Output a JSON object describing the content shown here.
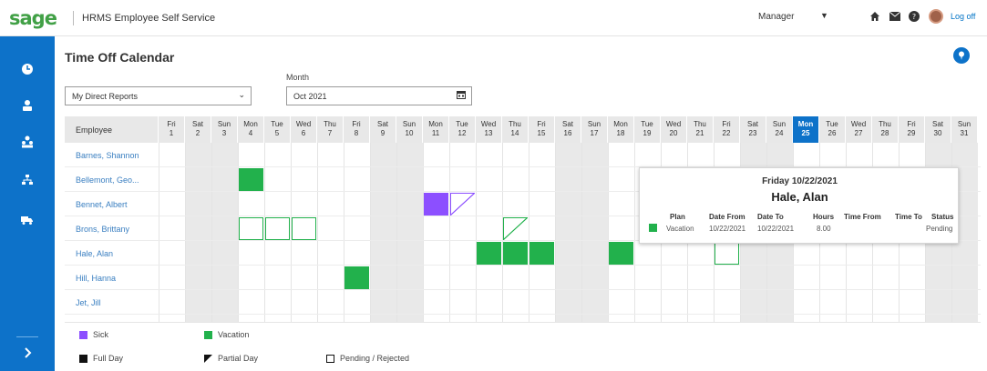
{
  "header": {
    "brand": "sage",
    "app_title": "HRMS Employee Self Service",
    "role": "Manager",
    "logoff": "Log off"
  },
  "page": {
    "title": "Time Off Calendar",
    "filter_value": "My Direct Reports",
    "month_label": "Month",
    "month_value": "Oct 2021"
  },
  "grid": {
    "employee_header": "Employee",
    "days": [
      {
        "dow": "Fri",
        "d": "1"
      },
      {
        "dow": "Sat",
        "d": "2"
      },
      {
        "dow": "Sun",
        "d": "3"
      },
      {
        "dow": "Mon",
        "d": "4"
      },
      {
        "dow": "Tue",
        "d": "5"
      },
      {
        "dow": "Wed",
        "d": "6"
      },
      {
        "dow": "Thu",
        "d": "7"
      },
      {
        "dow": "Fri",
        "d": "8"
      },
      {
        "dow": "Sat",
        "d": "9"
      },
      {
        "dow": "Sun",
        "d": "10"
      },
      {
        "dow": "Mon",
        "d": "11"
      },
      {
        "dow": "Tue",
        "d": "12"
      },
      {
        "dow": "Wed",
        "d": "13"
      },
      {
        "dow": "Thu",
        "d": "14"
      },
      {
        "dow": "Fri",
        "d": "15"
      },
      {
        "dow": "Sat",
        "d": "16"
      },
      {
        "dow": "Sun",
        "d": "17"
      },
      {
        "dow": "Mon",
        "d": "18"
      },
      {
        "dow": "Tue",
        "d": "19"
      },
      {
        "dow": "Wed",
        "d": "20"
      },
      {
        "dow": "Thu",
        "d": "21"
      },
      {
        "dow": "Fri",
        "d": "22"
      },
      {
        "dow": "Sat",
        "d": "23"
      },
      {
        "dow": "Sun",
        "d": "24"
      },
      {
        "dow": "Mon",
        "d": "25"
      },
      {
        "dow": "Tue",
        "d": "26"
      },
      {
        "dow": "Wed",
        "d": "27"
      },
      {
        "dow": "Thu",
        "d": "28"
      },
      {
        "dow": "Fri",
        "d": "29"
      },
      {
        "dow": "Sat",
        "d": "30"
      },
      {
        "dow": "Sun",
        "d": "31"
      }
    ],
    "today_day": 25,
    "employees": [
      {
        "name": "Barnes, Shannon",
        "events": []
      },
      {
        "name": "Bellemont, Geo...",
        "events": [
          {
            "day": 4,
            "plan": "vacation",
            "kind": "full"
          }
        ]
      },
      {
        "name": "Bennet, Albert",
        "events": [
          {
            "day": 11,
            "plan": "sick",
            "kind": "full"
          },
          {
            "day": 12,
            "plan": "sick",
            "kind": "partial"
          }
        ]
      },
      {
        "name": "Brons, Brittany",
        "events": [
          {
            "day": 4,
            "plan": "vacation",
            "kind": "pending"
          },
          {
            "day": 5,
            "plan": "vacation",
            "kind": "pending"
          },
          {
            "day": 6,
            "plan": "vacation",
            "kind": "pending"
          },
          {
            "day": 14,
            "plan": "vacation",
            "kind": "partial"
          }
        ]
      },
      {
        "name": "Hale, Alan",
        "events": [
          {
            "day": 13,
            "plan": "vacation",
            "kind": "full"
          },
          {
            "day": 14,
            "plan": "vacation",
            "kind": "full"
          },
          {
            "day": 15,
            "plan": "vacation",
            "kind": "full"
          },
          {
            "day": 18,
            "plan": "vacation",
            "kind": "full"
          },
          {
            "day": 22,
            "plan": "vacation",
            "kind": "pending"
          }
        ]
      },
      {
        "name": "Hill, Hanna",
        "events": [
          {
            "day": 8,
            "plan": "vacation",
            "kind": "full"
          }
        ]
      },
      {
        "name": "Jet, Jill",
        "events": []
      }
    ]
  },
  "tooltip": {
    "date": "Friday 10/22/2021",
    "name": "Hale, Alan",
    "headers": {
      "plan": "Plan",
      "date_from": "Date From",
      "date_to": "Date To",
      "hours": "Hours",
      "time_from": "Time From",
      "time_to": "Time To",
      "status": "Status"
    },
    "values": {
      "plan": "Vacation",
      "date_from": "10/22/2021",
      "date_to": "10/22/2021",
      "hours": "8.00",
      "time_from": "",
      "time_to": "",
      "status": "Pending"
    }
  },
  "legend": {
    "sick": "Sick",
    "vacation": "Vacation",
    "full_day": "Full Day",
    "partial_day": "Partial Day",
    "pending": "Pending / Rejected"
  },
  "colors": {
    "sick": "#8c4fff",
    "vacation": "#22b14c",
    "brand_blue": "#0d72c9",
    "brand_green": "#41a046"
  },
  "icons": {
    "rail": [
      "clock-icon",
      "person-icon",
      "team-icon",
      "org-chart-icon",
      "truck-icon",
      "chevron-right-icon"
    ],
    "header": [
      "home-icon",
      "mail-icon",
      "help-icon",
      "avatar"
    ]
  }
}
